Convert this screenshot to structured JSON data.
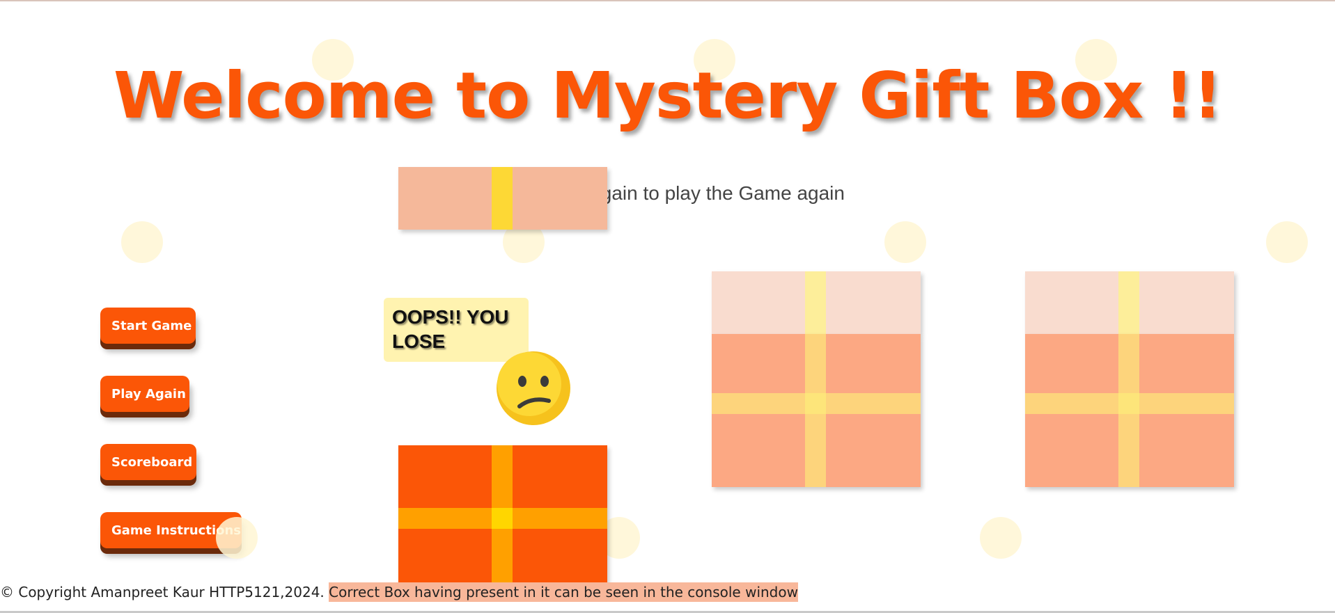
{
  "title": "Welcome to Mystery Gift Box !!",
  "subtitle": "Press Play Again to play the Game again",
  "buttons": {
    "start": "Start Game",
    "play_again": "Play Again",
    "scoreboard": "Scoreboard",
    "instructions": "Game Instructions"
  },
  "result_message": "OOPS!! YOU LOSE",
  "result_icon": "confused-face-icon",
  "footer": {
    "copyright": "© Copyright Amanpreet Kaur HTTP5121,2024.",
    "hint": "Correct Box having present in it can be seen in the console window"
  },
  "colors": {
    "accent": "#fb5607",
    "ribbon": "#ffa000",
    "bubble": "#fff3b0",
    "hint_highlight": "#f8b79a"
  }
}
